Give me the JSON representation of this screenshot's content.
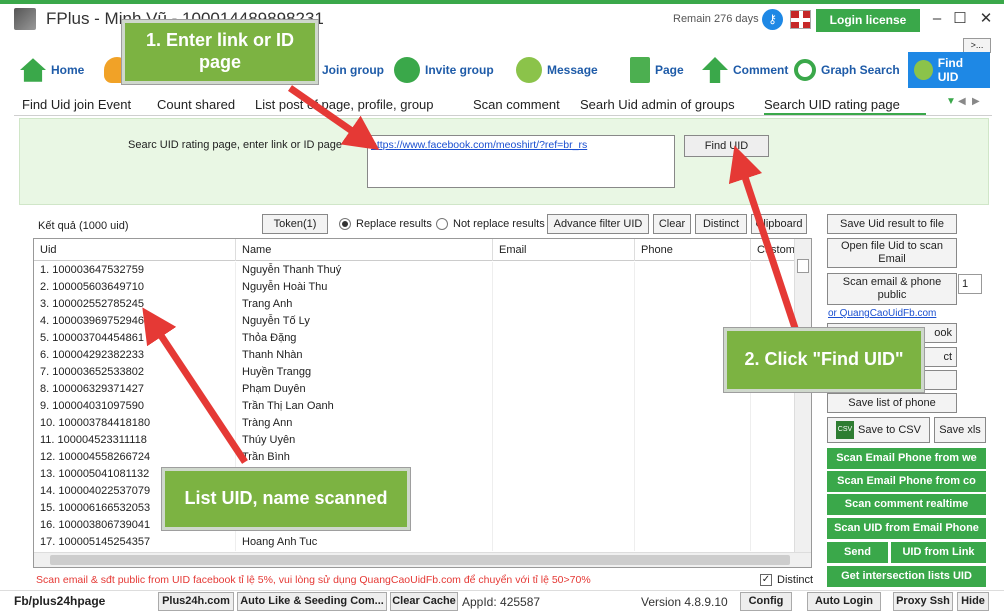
{
  "app": {
    "title": "FPlus - Minh Vũ - 100014489898231",
    "remain": "Remain 276 days",
    "login_license": "Login license",
    "minimize": "–",
    "maximize": "☐",
    "close": "✕",
    "more": ">..."
  },
  "main_tabs": [
    {
      "label": "Home",
      "icon": "home-icon"
    },
    {
      "label": "",
      "icon": "users-icon"
    },
    {
      "label": "Join group",
      "icon": "join-group-icon"
    },
    {
      "label": "Invite group",
      "icon": "invite-group-icon"
    },
    {
      "label": "Message",
      "icon": "message-icon"
    },
    {
      "label": "Page",
      "icon": "page-icon"
    },
    {
      "label": "Comment",
      "icon": "comment-icon"
    },
    {
      "label": "Graph Search",
      "icon": "search-icon"
    },
    {
      "label": "Find UID",
      "icon": "find-uid-icon"
    }
  ],
  "sub_tabs": [
    {
      "label": "Find Uid join Event"
    },
    {
      "label": "Count shared"
    },
    {
      "label": "List post of page, profile, group"
    },
    {
      "label": "Scan comment"
    },
    {
      "label": "Searh Uid admin of groups"
    },
    {
      "label": "Search UID rating page"
    }
  ],
  "search": {
    "label": "Searc UID rating page, enter link or ID page",
    "value": "https://www.facebook.com/meoshirt/?ref=br_rs",
    "find_button": "Find UID"
  },
  "results": {
    "label": "Kết quả (1000 uid)",
    "token_button": "Token(1)",
    "replace_label": "Replace results",
    "not_replace_label": "Not replace results",
    "advance_filter": "Advance filter UID",
    "clear": "Clear",
    "distinct": "Distinct",
    "clipboard": "Clipboard"
  },
  "table": {
    "columns": [
      "Uid",
      "Name",
      "Email",
      "Phone",
      "Custom"
    ],
    "rows": [
      {
        "uid": "1. 100003647532759",
        "name": "Nguyễn Thanh Thuý"
      },
      {
        "uid": "2. 100005603649710",
        "name": "Nguyễn Hoài Thu"
      },
      {
        "uid": "3. 100002552785245",
        "name": "Trang Anh"
      },
      {
        "uid": "4. 100003969752946",
        "name": "Nguyễn Tố Ly"
      },
      {
        "uid": "5. 100003704454861",
        "name": "Thỏa Đặng"
      },
      {
        "uid": "6. 100004292382233",
        "name": "Thanh Nhàn"
      },
      {
        "uid": "7. 100003652533802",
        "name": "Huyền Trangg"
      },
      {
        "uid": "8. 100006329371427",
        "name": "Phạm Duyên"
      },
      {
        "uid": "9. 100004031097590",
        "name": "Trần Thị Lan Oanh"
      },
      {
        "uid": "10. 100003784418180",
        "name": "Tràng Ann"
      },
      {
        "uid": "11. 100004523311118",
        "name": "Thúy Uyên"
      },
      {
        "uid": "12. 100004558266724",
        "name": "Trần Bình"
      },
      {
        "uid": "13. 100005041081132",
        "name": ""
      },
      {
        "uid": "14. 100004022537079",
        "name": ""
      },
      {
        "uid": "15. 100006166532053",
        "name": ""
      },
      {
        "uid": "16. 100003806739041",
        "name": ""
      },
      {
        "uid": "17. 100005145254357",
        "name": "Hoang Anh Tuc"
      }
    ]
  },
  "right_panel": {
    "save_uid": "Save Uid result to file",
    "open_file": "Open file Uid to scan Email",
    "scan_email_phone": "Scan email & phone public",
    "spin_value": "1",
    "link": "or QuangCaoUidFb.com",
    "btn_ook": "ook",
    "btn_ct": "ct",
    "save_phone": "Save list of phone",
    "save_csv": "Save to CSV",
    "save_xls": "Save xls",
    "green": [
      "Scan Email Phone from we",
      "Scan Email Phone from co",
      "Scan comment realtime",
      "Scan UID from Email Phone",
      "Send",
      "UID from Link",
      "Get intersection lists UID"
    ]
  },
  "notice": "Scan email & sđt public from UID facebook tỉ lệ 5%, vui lòng sử dụng QuangCaoUidFb.com để chuyển với tỉ lệ 50>70%",
  "distinct_check": "Distinct",
  "status": {
    "fb": "Fb/plus24hpage",
    "buttons": [
      "Plus24h.com",
      "Auto Like & Seeding Com...",
      "Clear Cache"
    ],
    "appid": "AppId: 425587",
    "version": "Version 4.8.9.10",
    "right_buttons": [
      "Config",
      "Auto Login",
      "Proxy Ssh",
      "Hide"
    ]
  },
  "callouts": {
    "c1": "1. Enter link or ID page",
    "c2": "2. Click \"Find UID\"",
    "c3": "List UID, name scanned"
  },
  "colors": {
    "brand_green": "#3aa84a",
    "accent_blue": "#1e88e5",
    "callout_green": "#7cb342",
    "arrow_red": "#e53935"
  }
}
